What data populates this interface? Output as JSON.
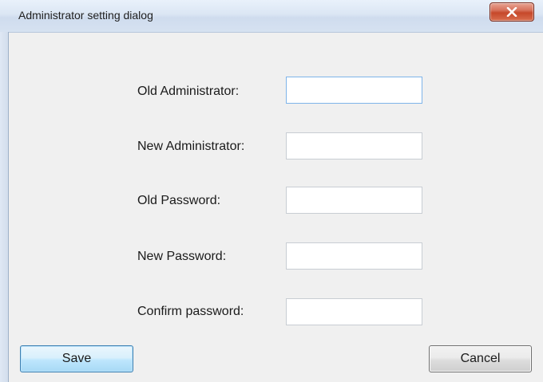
{
  "window": {
    "title": "Administrator setting dialog",
    "close_label": "X"
  },
  "form": {
    "old_admin_label": "Old Administrator:",
    "new_admin_label": "New Administrator:",
    "old_password_label": "Old Password:",
    "new_password_label": "New Password:",
    "confirm_password_label": "Confirm password:",
    "old_admin_value": "",
    "new_admin_value": "",
    "old_password_value": "",
    "new_password_value": "",
    "confirm_password_value": ""
  },
  "buttons": {
    "save_label": "Save",
    "cancel_label": "Cancel"
  },
  "colors": {
    "focus_border": "#7eb4ea",
    "client_background": "#f0f0f0",
    "close_button": "#c6482a"
  }
}
